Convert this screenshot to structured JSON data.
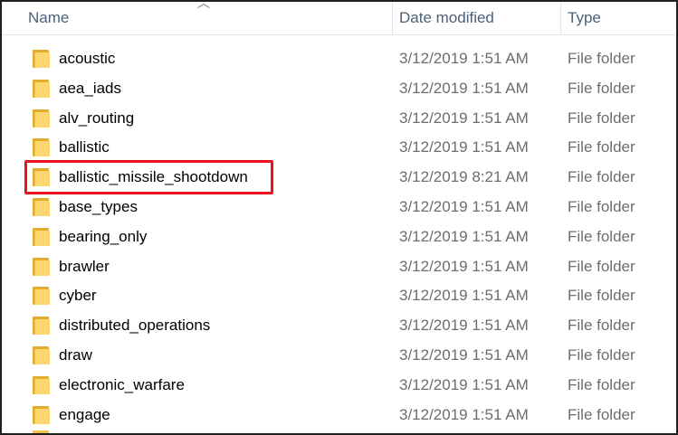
{
  "columns": {
    "name": "Name",
    "date_modified": "Date modified",
    "type": "Type"
  },
  "rows": [
    {
      "name": "acoustic",
      "date": "3/12/2019 1:51 AM",
      "type": "File folder"
    },
    {
      "name": "aea_iads",
      "date": "3/12/2019 1:51 AM",
      "type": "File folder"
    },
    {
      "name": "alv_routing",
      "date": "3/12/2019 1:51 AM",
      "type": "File folder"
    },
    {
      "name": "ballistic",
      "date": "3/12/2019 1:51 AM",
      "type": "File folder"
    },
    {
      "name": "ballistic_missile_shootdown",
      "date": "3/12/2019 8:21 AM",
      "type": "File folder",
      "highlighted": true
    },
    {
      "name": "base_types",
      "date": "3/12/2019 1:51 AM",
      "type": "File folder"
    },
    {
      "name": "bearing_only",
      "date": "3/12/2019 1:51 AM",
      "type": "File folder"
    },
    {
      "name": "brawler",
      "date": "3/12/2019 1:51 AM",
      "type": "File folder"
    },
    {
      "name": "cyber",
      "date": "3/12/2019 1:51 AM",
      "type": "File folder"
    },
    {
      "name": "distributed_operations",
      "date": "3/12/2019 1:51 AM",
      "type": "File folder"
    },
    {
      "name": "draw",
      "date": "3/12/2019 1:51 AM",
      "type": "File folder"
    },
    {
      "name": "electronic_warfare",
      "date": "3/12/2019 1:51 AM",
      "type": "File folder"
    },
    {
      "name": "engage",
      "date": "3/12/2019 1:51 AM",
      "type": "File folder"
    }
  ],
  "colors": {
    "highlight_border": "#e8141b",
    "folder": "#fcd671",
    "header_text": "#4c607a"
  },
  "icons": {
    "folder": "folder-icon",
    "sort": "sort-chevron-icon"
  }
}
